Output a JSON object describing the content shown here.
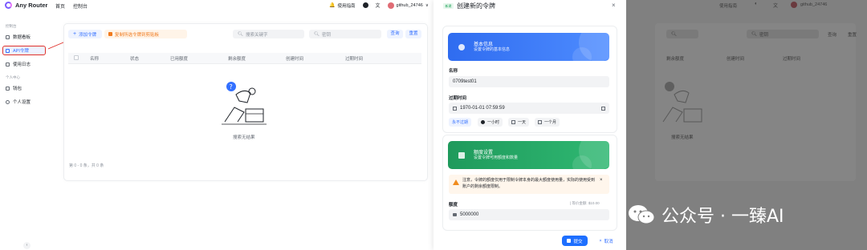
{
  "app": {
    "title": "Any Router"
  },
  "topnav": {
    "home": "首页",
    "console": "控制台"
  },
  "topbar_right": {
    "guide": "使用指南",
    "username": "github_24746",
    "dropdown": "∨"
  },
  "sidebar": {
    "group_console": "控制台",
    "group_personal": "个人中心",
    "items": [
      {
        "label": "数据看板"
      },
      {
        "label": "API令牌"
      },
      {
        "label": "使用日志"
      },
      {
        "label": "钱包"
      },
      {
        "label": "个人设置"
      }
    ],
    "collapse": "‹"
  },
  "toolbar": {
    "add_token": "添加令牌",
    "copy_selected": "复制所选令牌到剪贴板",
    "search_keyword_placeholder": "搜索关键字",
    "search_key_placeholder": "密钥",
    "query": "查询",
    "reset": "重置"
  },
  "table": {
    "columns": [
      "名称",
      "状态",
      "已用额度",
      "剩余额度",
      "创建时间",
      "过期时间"
    ],
    "empty_text": "搜索无结果",
    "pager": "第 0 - 0 条，共 0 条"
  },
  "drawer": {
    "tag": "新建",
    "title": "创建新的令牌",
    "close": "×",
    "basic": {
      "title": "基本信息",
      "subtitle": "设置令牌的基本信息"
    },
    "name_label": "名称",
    "name_value": "0709test01",
    "expire_label": "过期时间",
    "expire_value": "1970-01-01 07:59:59",
    "expire_options": [
      "永不过期",
      "一小时",
      "一天",
      "一个月"
    ],
    "quota": {
      "title": "额度设置",
      "subtitle": "设置令牌可用额度和数量"
    },
    "notice": "注意，令牌的额度仅用于限制令牌本身的最大额度使用量，实际的使用受到账户的剩余额度限制。",
    "notice_close": "×",
    "quota_label": "额度",
    "quota_hint": "| 等价金额: $10.00",
    "quota_value": "5000000",
    "submit": "提交",
    "cancel": "取消"
  },
  "overlay": {
    "guide": "使用指南",
    "username": "github_24746",
    "search_placeholder": "密钥",
    "query": "查询",
    "reset": "重置",
    "columns": [
      "剩余额度",
      "创建时间",
      "过期时间"
    ],
    "empty_text": "搜索无结果",
    "watermark": "公众号 · 一臻AI"
  },
  "colors": {
    "primary": "#3370ff",
    "basic_banner": "#2f6cf0",
    "quota_banner": "#1f9a5c",
    "highlight": "#e0312b"
  }
}
